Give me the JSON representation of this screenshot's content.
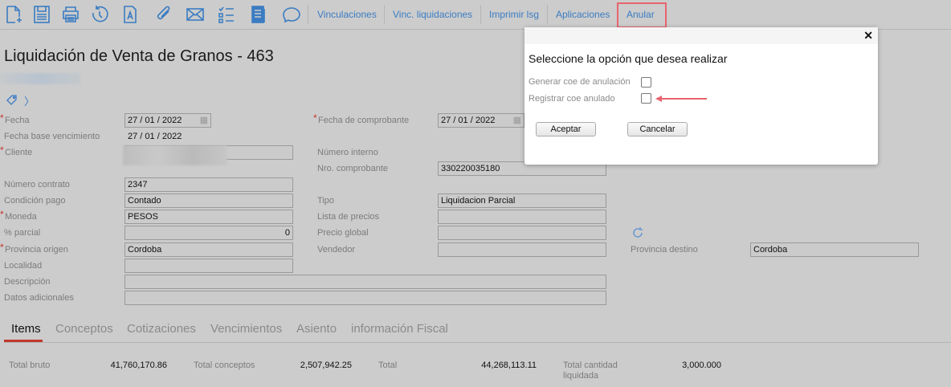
{
  "toolbar": {
    "icons": [
      "new-document-icon",
      "save-icon",
      "print-icon",
      "history-icon",
      "text-document-icon",
      "attachment-icon",
      "email-icon",
      "checklist-icon",
      "report-icon",
      "comment-icon"
    ],
    "links": [
      "Vinculaciones",
      "Vinc. liquidaciones",
      "Imprimir lsg",
      "Aplicaciones",
      "Anular"
    ],
    "highlight_color": "#e8646e"
  },
  "page": {
    "title": "Liquidación de Venta de Granos - 463"
  },
  "form": {
    "fecha_label": "Fecha",
    "fecha": {
      "d": "27",
      "m": "01",
      "y": "2022"
    },
    "fecha_base_label": "Fecha base vencimiento",
    "fecha_base": {
      "d": "27",
      "m": "01",
      "y": "2022"
    },
    "cliente_label": "Cliente",
    "numero_contrato_label": "Número contrato",
    "numero_contrato": "2347",
    "condicion_pago_label": "Condición pago",
    "condicion_pago": "Contado",
    "moneda_label": "Moneda",
    "moneda": "PESOS",
    "parcial_label": "% parcial",
    "parcial": "0",
    "provincia_origen_label": "Provincia origen",
    "provincia_origen": "Cordoba",
    "localidad_label": "Localidad",
    "descripcion_label": "Descripción",
    "datos_adicionales_label": "Datos adicionales",
    "fecha_comprobante_label": "Fecha de comprobante",
    "fecha_comprobante": {
      "d": "27",
      "m": "01",
      "y": "2022"
    },
    "numero_interno_label": "Número interno",
    "nro_comprobante_label": "Nro. comprobante",
    "nro_comprobante": "330220035180",
    "tipo_label": "Tipo",
    "tipo": "Liquidacion Parcial",
    "lista_precios_label": "Lista de precios",
    "precio_global_label": "Precio global",
    "vendedor_label": "Vendedor",
    "provincia_destino_label": "Provincia destino",
    "provincia_destino": "Cordoba"
  },
  "tabs": [
    {
      "label": "Items",
      "active": true
    },
    {
      "label": "Conceptos"
    },
    {
      "label": "Cotizaciones"
    },
    {
      "label": "Vencimientos"
    },
    {
      "label": "Asiento"
    },
    {
      "label": "información Fiscal"
    }
  ],
  "totals": {
    "bruto_label": "Total bruto",
    "bruto": "41,760,170.86",
    "conceptos_label": "Total conceptos",
    "conceptos": "2,507,942.25",
    "total_label": "Total",
    "total": "44,268,113.11",
    "cantidad_label_1": "Total cantidad",
    "cantidad_label_2": "liquidada",
    "cantidad": "3,000.000"
  },
  "modal": {
    "close": "✕",
    "title": "Seleccione la opción que desea realizar",
    "options": [
      {
        "label": "Generar coe de anulación",
        "checked": false
      },
      {
        "label": "Registrar coe anulado",
        "checked": false
      }
    ],
    "accept": "Aceptar",
    "cancel": "Cancelar",
    "arrow_color": "#e8646e"
  }
}
